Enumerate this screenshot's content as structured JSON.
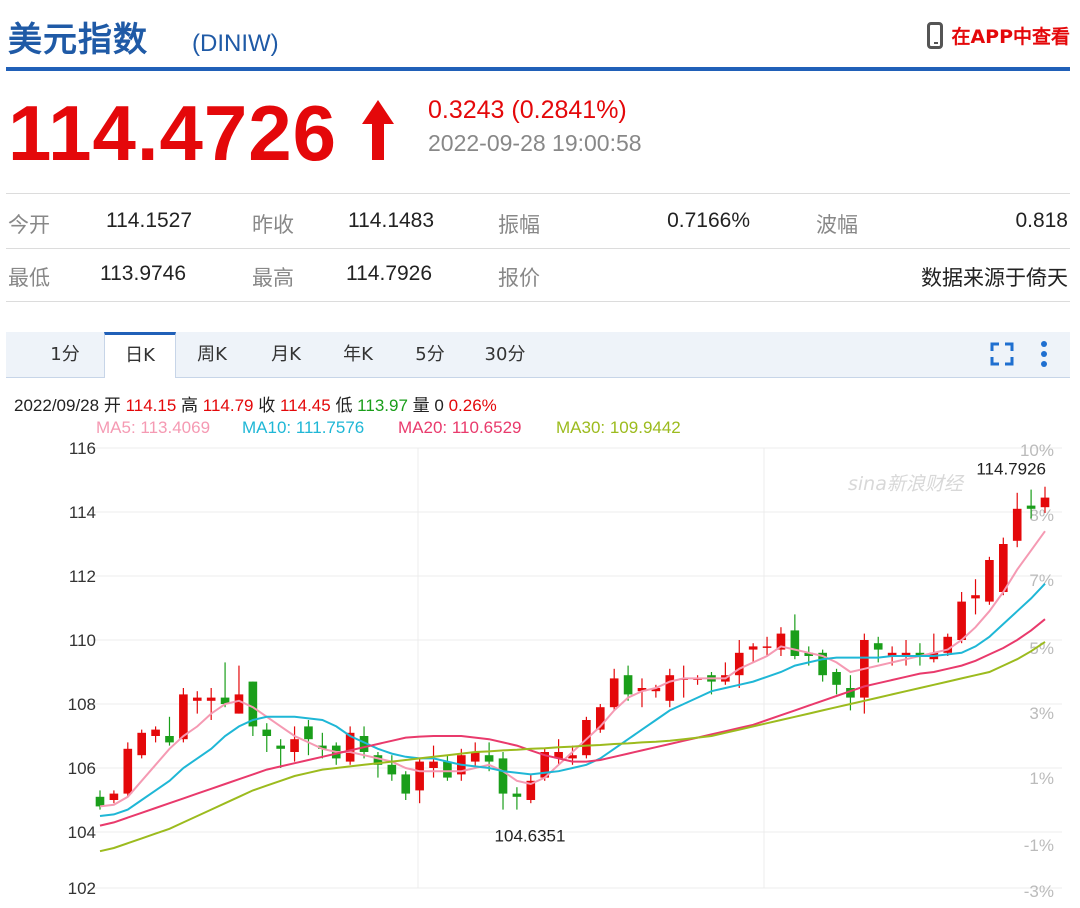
{
  "header": {
    "title": "美元指数",
    "code": "(DINIW)",
    "app_link": "在APP中查看"
  },
  "quote": {
    "price": "114.4726",
    "direction": "up",
    "change": "0.3243 (0.2841%)",
    "datetime": "2022-09-28 19:00:58"
  },
  "stats": {
    "open_label": "今开",
    "open": "114.1527",
    "prev_close_label": "昨收",
    "prev_close": "114.1483",
    "amplitude_label": "振幅",
    "amplitude": "0.7166%",
    "wave_label": "波幅",
    "wave": "0.818",
    "low_label": "最低",
    "low": "113.9746",
    "high_label": "最高",
    "high": "114.7926",
    "quote_label": "报价",
    "source": "数据来源于倚天"
  },
  "tabs": [
    "1分",
    "日K",
    "周K",
    "月K",
    "年K",
    "5分",
    "30分"
  ],
  "active_tab": "日K",
  "bar_info": {
    "date": "2022/09/28",
    "open_label": "开",
    "open": "114.15",
    "high_label": "高",
    "high": "114.79",
    "close_label": "收",
    "close": "114.45",
    "low_label": "低",
    "low": "113.97",
    "vol_label": "量",
    "vol": "0",
    "pct": "0.26%"
  },
  "ma_legend": {
    "ma5": "MA5: 113.4069",
    "ma10": "MA10: 111.7576",
    "ma20": "MA20: 110.6529",
    "ma30": "MA30: 109.9442"
  },
  "colors": {
    "up": "#e4080a",
    "down": "#1a9e1a",
    "brand": "#1f5aa6",
    "ma5": "#f59ab3",
    "ma10": "#1fb7d6",
    "ma20": "#e93a6c",
    "ma30": "#9cbb1e"
  },
  "watermark": "sina新浪财经",
  "chart_data": {
    "type": "candlestick",
    "ylim": [
      102,
      116
    ],
    "y_ticks": [
      "116",
      "114",
      "112",
      "110",
      "108",
      "106",
      "104",
      "102"
    ],
    "y_ticks_right": [
      "10%",
      "8%",
      "7%",
      "5%",
      "3%",
      "1%",
      "-1%",
      "-3%"
    ],
    "max_label": "114.7926",
    "min_label": "104.6351",
    "candles": [
      [
        105.1,
        104.8,
        105.3,
        104.7
      ],
      [
        105.0,
        105.2,
        105.3,
        104.9
      ],
      [
        105.2,
        106.6,
        106.8,
        105.1
      ],
      [
        106.4,
        107.1,
        107.2,
        106.3
      ],
      [
        107.0,
        107.2,
        107.3,
        106.8
      ],
      [
        107.0,
        106.8,
        107.6,
        106.7
      ],
      [
        106.9,
        108.3,
        108.5,
        106.8
      ],
      [
        108.1,
        108.2,
        108.4,
        107.7
      ],
      [
        108.1,
        108.2,
        108.5,
        107.5
      ],
      [
        108.2,
        108.0,
        109.3,
        107.9
      ],
      [
        107.7,
        108.3,
        109.2,
        107.7
      ],
      [
        108.7,
        107.3,
        108.7,
        107.0
      ],
      [
        107.2,
        107.0,
        107.4,
        106.5
      ],
      [
        106.7,
        106.6,
        106.9,
        106.0
      ],
      [
        106.5,
        106.9,
        107.3,
        106.2
      ],
      [
        107.3,
        106.9,
        107.5,
        106.4
      ],
      [
        106.7,
        106.6,
        107.1,
        106.3
      ],
      [
        106.7,
        106.3,
        106.8,
        106.1
      ],
      [
        106.2,
        107.1,
        107.3,
        106.1
      ],
      [
        107.0,
        106.5,
        107.3,
        106.3
      ],
      [
        106.4,
        106.1,
        106.5,
        105.7
      ],
      [
        106.1,
        105.8,
        106.4,
        105.6
      ],
      [
        105.8,
        105.2,
        105.9,
        105.0
      ],
      [
        105.3,
        106.2,
        106.3,
        104.9
      ],
      [
        106.0,
        106.2,
        106.7,
        105.7
      ],
      [
        106.2,
        105.7,
        106.4,
        105.6
      ],
      [
        105.8,
        106.4,
        106.6,
        105.6
      ],
      [
        106.2,
        106.5,
        106.8,
        106.0
      ],
      [
        106.4,
        106.2,
        106.8,
        105.9
      ],
      [
        106.3,
        105.2,
        106.5,
        104.7
      ],
      [
        105.2,
        105.1,
        105.4,
        104.7
      ],
      [
        105.0,
        105.6,
        105.8,
        104.9
      ],
      [
        105.7,
        106.5,
        106.6,
        105.6
      ],
      [
        106.3,
        106.5,
        106.9,
        106.1
      ],
      [
        106.3,
        106.4,
        106.7,
        106.1
      ],
      [
        106.4,
        107.5,
        107.6,
        106.3
      ],
      [
        107.2,
        107.9,
        108.0,
        107.1
      ],
      [
        107.9,
        108.8,
        109.1,
        107.8
      ],
      [
        108.9,
        108.3,
        109.2,
        108.1
      ],
      [
        108.4,
        108.5,
        108.8,
        107.9
      ],
      [
        108.4,
        108.5,
        108.6,
        108.2
      ],
      [
        108.1,
        108.9,
        109.1,
        107.9
      ],
      [
        108.8,
        108.8,
        109.2,
        108.2
      ],
      [
        108.8,
        108.8,
        108.9,
        108.6
      ],
      [
        108.9,
        108.7,
        109.0,
        108.3
      ],
      [
        108.7,
        108.9,
        109.3,
        108.6
      ],
      [
        108.9,
        109.6,
        110.0,
        108.5
      ],
      [
        109.7,
        109.8,
        109.9,
        109.3
      ],
      [
        109.8,
        109.8,
        110.1,
        109.5
      ],
      [
        109.7,
        110.2,
        110.4,
        109.5
      ],
      [
        110.3,
        109.5,
        110.8,
        109.4
      ],
      [
        109.6,
        109.5,
        109.8,
        109.2
      ],
      [
        109.6,
        108.9,
        109.7,
        108.7
      ],
      [
        109.0,
        108.6,
        109.1,
        108.3
      ],
      [
        108.5,
        108.2,
        108.9,
        107.8
      ],
      [
        108.2,
        110.0,
        110.2,
        107.7
      ],
      [
        109.9,
        109.7,
        110.1,
        109.3
      ],
      [
        109.5,
        109.6,
        109.8,
        109.2
      ],
      [
        109.5,
        109.6,
        110.0,
        109.2
      ],
      [
        109.6,
        109.5,
        109.9,
        109.2
      ],
      [
        109.4,
        109.6,
        110.2,
        109.3
      ],
      [
        109.6,
        110.1,
        110.2,
        109.5
      ],
      [
        110.0,
        111.2,
        111.5,
        109.9
      ],
      [
        111.3,
        111.4,
        111.9,
        110.8
      ],
      [
        111.2,
        112.5,
        112.6,
        111.1
      ],
      [
        111.5,
        113.0,
        113.2,
        111.4
      ],
      [
        113.1,
        114.1,
        114.6,
        112.9
      ],
      [
        114.2,
        114.1,
        114.7,
        113.8
      ],
      [
        114.15,
        114.45,
        114.79,
        113.97
      ]
    ],
    "ma_series": [
      {
        "name": "MA5",
        "values": [
          104.8,
          104.85,
          105.1,
          105.6,
          106.1,
          106.6,
          107.0,
          107.3,
          107.7,
          108.0,
          108.1,
          107.9,
          107.6,
          107.3,
          107.0,
          106.8,
          106.6,
          106.5,
          106.5,
          106.4,
          106.3,
          106.2,
          106.0,
          105.9,
          105.9,
          105.9,
          105.9,
          106.0,
          106.1,
          105.9,
          105.6,
          105.5,
          105.7,
          106.1,
          106.5,
          106.9,
          107.3,
          107.8,
          108.2,
          108.4,
          108.5,
          108.7,
          108.8,
          108.8,
          108.8,
          108.8,
          109.1,
          109.3,
          109.5,
          109.8,
          109.7,
          109.6,
          109.5,
          109.3,
          109.0,
          109.1,
          109.2,
          109.3,
          109.4,
          109.5,
          109.6,
          109.7,
          110.0,
          110.4,
          110.9,
          111.5,
          112.2,
          112.8,
          113.4
        ]
      },
      {
        "name": "MA10",
        "values": [
          104.5,
          104.55,
          104.7,
          105.0,
          105.3,
          105.6,
          106.0,
          106.3,
          106.6,
          107.0,
          107.3,
          107.5,
          107.6,
          107.6,
          107.6,
          107.55,
          107.5,
          107.3,
          107.0,
          106.8,
          106.6,
          106.45,
          106.35,
          106.3,
          106.3,
          106.2,
          106.1,
          106.05,
          106.0,
          105.9,
          105.85,
          105.8,
          105.85,
          105.9,
          106.0,
          106.1,
          106.3,
          106.6,
          106.9,
          107.2,
          107.5,
          107.8,
          108.0,
          108.2,
          108.4,
          108.5,
          108.6,
          108.7,
          108.85,
          109.0,
          109.2,
          109.3,
          109.4,
          109.45,
          109.45,
          109.45,
          109.45,
          109.5,
          109.5,
          109.5,
          109.5,
          109.55,
          109.6,
          109.8,
          110.1,
          110.5,
          110.9,
          111.3,
          111.76
        ]
      },
      {
        "name": "MA20",
        "values": [
          104.2,
          104.3,
          104.45,
          104.6,
          104.75,
          104.9,
          105.05,
          105.2,
          105.35,
          105.5,
          105.65,
          105.8,
          105.95,
          106.05,
          106.15,
          106.25,
          106.35,
          106.45,
          106.55,
          106.65,
          106.75,
          106.85,
          106.95,
          106.98,
          107.0,
          107.0,
          107.0,
          106.95,
          106.9,
          106.8,
          106.7,
          106.55,
          106.4,
          106.3,
          106.2,
          106.2,
          106.25,
          106.35,
          106.45,
          106.55,
          106.65,
          106.75,
          106.85,
          106.95,
          107.05,
          107.15,
          107.25,
          107.35,
          107.5,
          107.65,
          107.8,
          107.95,
          108.1,
          108.25,
          108.4,
          108.55,
          108.65,
          108.75,
          108.85,
          108.95,
          109.0,
          109.1,
          109.2,
          109.35,
          109.55,
          109.75,
          110.0,
          110.3,
          110.65
        ]
      },
      {
        "name": "MA30",
        "values": [
          103.4,
          103.5,
          103.65,
          103.8,
          103.95,
          104.1,
          104.3,
          104.5,
          104.7,
          104.9,
          105.1,
          105.3,
          105.45,
          105.6,
          105.75,
          105.85,
          105.95,
          106.0,
          106.05,
          106.1,
          106.15,
          106.2,
          106.25,
          106.3,
          106.35,
          106.4,
          106.45,
          106.5,
          106.52,
          106.55,
          106.57,
          106.6,
          106.62,
          106.65,
          106.67,
          106.7,
          106.72,
          106.75,
          106.77,
          106.8,
          106.82,
          106.85,
          106.9,
          106.95,
          107.0,
          107.1,
          107.2,
          107.3,
          107.4,
          107.5,
          107.6,
          107.7,
          107.8,
          107.9,
          108.0,
          108.1,
          108.2,
          108.3,
          108.4,
          108.5,
          108.6,
          108.7,
          108.8,
          108.9,
          109.0,
          109.2,
          109.4,
          109.65,
          109.94
        ]
      }
    ],
    "grid": true
  }
}
